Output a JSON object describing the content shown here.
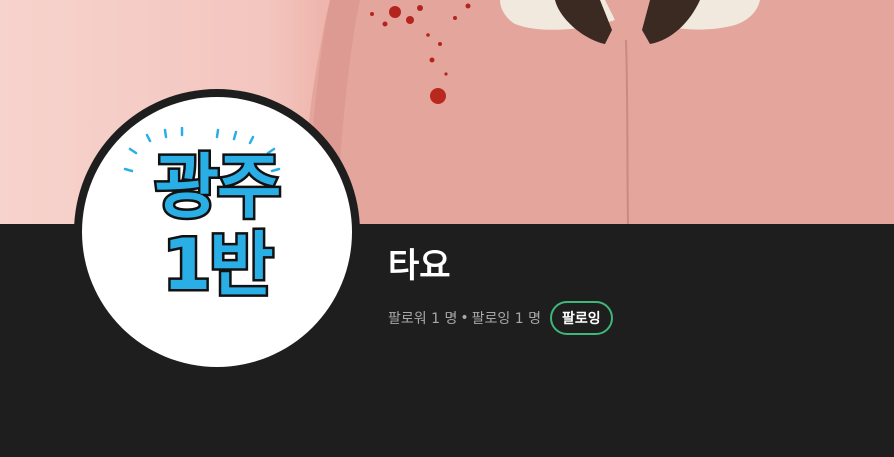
{
  "banner": {
    "image": "pink-coat-cover-photo"
  },
  "profile": {
    "avatar_line1": "광주",
    "avatar_line2": "1반",
    "username": "타요",
    "followers_label": "팔로워",
    "followers_count": "1",
    "following_label": "팔로잉",
    "following_count": "1",
    "count_unit": "명",
    "separator": "•",
    "follow_button_label": "팔로잉"
  },
  "colors": {
    "background": "#1e1e1e",
    "accent_green": "#3fb67a",
    "avatar_text": "#2aaee6"
  }
}
